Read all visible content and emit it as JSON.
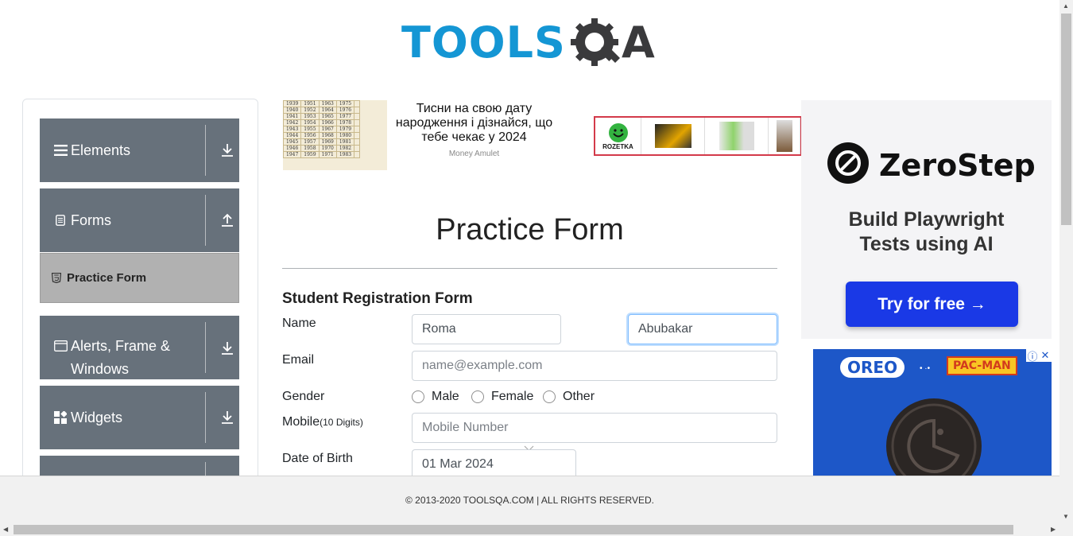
{
  "logo": {
    "text": "TOOLS",
    "text_end": "A"
  },
  "sidebar": {
    "groups": [
      {
        "label": "Elements",
        "icon": "hamburger-icon",
        "arrow": "download-icon"
      },
      {
        "label": "Forms",
        "icon": "document-icon",
        "arrow": "upload-icon"
      },
      {
        "label": "Alerts, Frame & Windows",
        "icon": "window-icon",
        "arrow": "download-icon"
      },
      {
        "label": "Widgets",
        "icon": "widgets-icon",
        "arrow": "download-icon"
      }
    ],
    "active_item": {
      "label": "Practice Form",
      "icon": "html5-icon"
    }
  },
  "ads": {
    "top_left": {
      "text": "Тисни на свою дату народження і дізнайся, що тебе чекає у 2024",
      "sponsor": "Money Amulet"
    },
    "top_right": {
      "brand": "ROZETKA"
    },
    "zerostep": {
      "name": "ZeroStep",
      "tagline_1": "Build Playwright",
      "tagline_2": "Tests using AI",
      "button": "Try for free →"
    },
    "oreo": {
      "brand": "OREO",
      "partner": "PAC-MAN"
    }
  },
  "form": {
    "page_title": "Practice Form",
    "subtitle": "Student Registration Form",
    "name_label": "Name",
    "first_name_value": "Roma",
    "last_name_value": "Abubakar",
    "email_label": "Email",
    "email_placeholder": "name@example.com",
    "gender_label": "Gender",
    "gender_options": [
      "Male",
      "Female",
      "Other"
    ],
    "mobile_label": "Mobile",
    "mobile_hint": "(10 Digits)",
    "mobile_placeholder": "Mobile Number",
    "dob_label": "Date of Birth",
    "dob_value": "01 Mar 2024"
  },
  "footer": {
    "text": "© 2013-2020 TOOLSQA.COM | ALL RIGHTS RESERVED."
  },
  "colors": {
    "sidebar_group": "#67717b",
    "active_item": "#b1b1b1",
    "logo_blue": "#1496d4",
    "zerostep_button": "#1a39e6",
    "oreo_blue": "#1d57c8"
  }
}
